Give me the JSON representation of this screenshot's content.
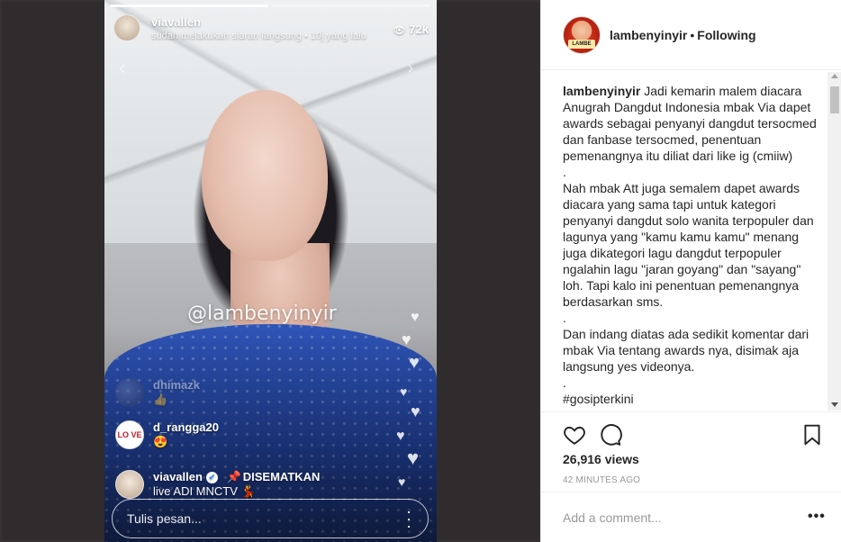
{
  "live": {
    "username": "viavallen",
    "subtitle": "sudah melakukan siaran langsung • 10j yang lalu",
    "viewers": "72k",
    "watermark": "@lambenyinyir",
    "comments": [
      {
        "user": "dhimazk",
        "text": "👍",
        "faded": true
      },
      {
        "user": "d_rangga20",
        "text": "😍",
        "avatar_text": "LO VE"
      },
      {
        "user": "viavallen",
        "text": "live ADI MNCTV 💃",
        "pinned_label": "DISEMATKAN"
      }
    ],
    "comment_placeholder": "Tulis pesan..."
  },
  "post": {
    "username": "lambenyinyir",
    "follow_status": "Following",
    "avatar_badge": "LAMBE",
    "caption_user": "lambenyinyir",
    "caption_text": " Jadi kemarin malem diacara Anugrah Dangdut Indonesia mbak Via dapet awards sebagai penyanyi dangdut tersocmed dan fanbase tersocmed, penentuan pemenangnya itu diliat dari like ig (cmiiw)\n.\nNah mbak Att juga semalem dapet awards diacara yang sama tapi untuk kategori penyanyi dangdut solo wanita terpopuler dan lagunya yang \"kamu kamu kamu\" menang juga dikategori lagu dangdut terpopuler ngalahin lagu \"jaran goyang\" dan \"sayang\" loh. Tapi kalo ini penentuan pemenangnya berdasarkan sms.\n.\nDan indang diatas ada sedikit komentar dari mbak Via tentang awards nya, disimak aja langsung yes videonya.\n.\n#gosipterkini",
    "views": "26,916 views",
    "time_ago": "42 MINUTES AGO",
    "add_comment_placeholder": "Add a comment..."
  },
  "colors": {
    "text": "#262626",
    "muted": "#999999",
    "border": "#efefef",
    "dress": "#2f55b8"
  }
}
